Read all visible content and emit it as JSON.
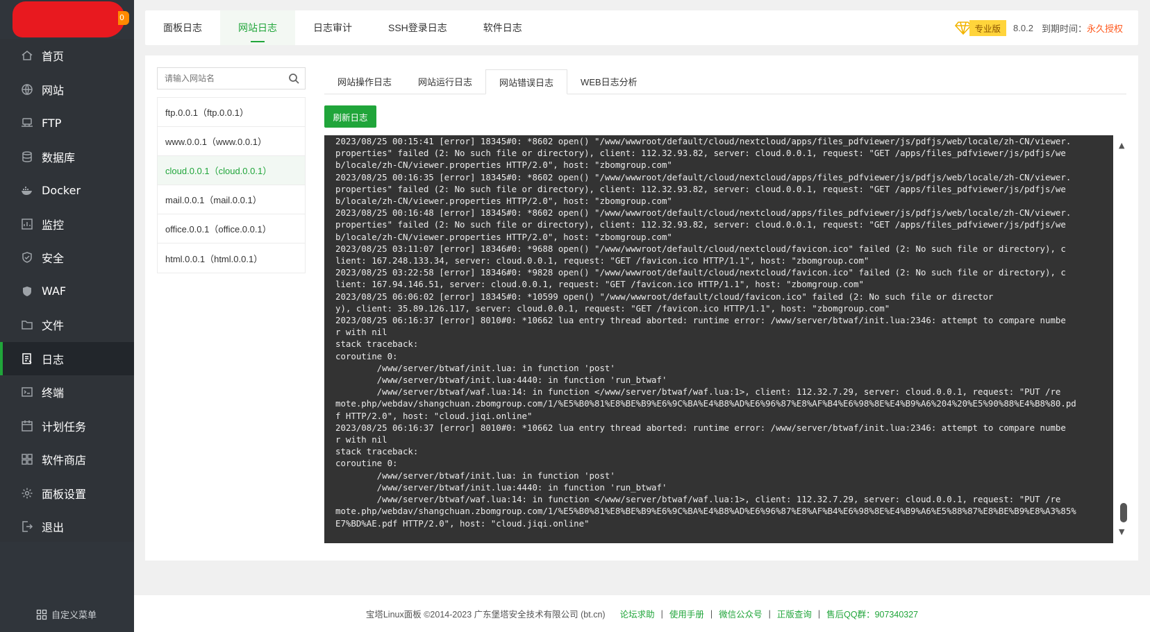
{
  "sidebar": {
    "brand_badge": "0",
    "items": [
      {
        "label": "首页",
        "icon": "home-icon"
      },
      {
        "label": "网站",
        "icon": "globe-icon"
      },
      {
        "label": "FTP",
        "icon": "ftp-icon"
      },
      {
        "label": "数据库",
        "icon": "database-icon"
      },
      {
        "label": "Docker",
        "icon": "docker-icon"
      },
      {
        "label": "监控",
        "icon": "monitor-icon"
      },
      {
        "label": "安全",
        "icon": "shield-icon"
      },
      {
        "label": "WAF",
        "icon": "waf-shield-icon"
      },
      {
        "label": "文件",
        "icon": "folder-icon"
      },
      {
        "label": "日志",
        "icon": "log-icon"
      },
      {
        "label": "终端",
        "icon": "terminal-icon"
      },
      {
        "label": "计划任务",
        "icon": "calendar-icon"
      },
      {
        "label": "软件商店",
        "icon": "grid-icon"
      },
      {
        "label": "面板设置",
        "icon": "gear-icon"
      },
      {
        "label": "退出",
        "icon": "logout-icon"
      }
    ],
    "custom_menu": "自定义菜单"
  },
  "topnav": {
    "tabs": [
      "面板日志",
      "网站日志",
      "日志审计",
      "SSH登录日志",
      "软件日志"
    ],
    "pro_label": "专业版",
    "version": "8.0.2",
    "expire_label": "到期时间：",
    "expire_value": "永久授权"
  },
  "search": {
    "placeholder": "请输入网站名"
  },
  "sites": [
    "ftp.0.0.1（ftp.0.0.1）",
    "www.0.0.1（www.0.0.1）",
    "cloud.0.0.1（cloud.0.0.1）",
    "mail.0.0.1（mail.0.0.1）",
    "office.0.0.1（office.0.0.1）",
    "html.0.0.1（html.0.0.1）"
  ],
  "subtabs": [
    "网站操作日志",
    "网站运行日志",
    "网站错误日志",
    "WEB日志分析"
  ],
  "refresh_label": "刷新日志",
  "log": {
    "text": "2023/08/25 00:15:41 [error] 18345#0: *8602 open() \"/www/wwwroot/default/cloud/nextcloud/apps/files_pdfviewer/js/pdfjs/web/locale/zh-CN/viewer.\nproperties\" failed (2: No such file or directory), client: 112.32.93.82, server: cloud.0.0.1, request: \"GET /apps/files_pdfviewer/js/pdfjs/we\nb/locale/zh-CN/viewer.properties HTTP/2.0\", host: \"zbomgroup.com\"\n2023/08/25 00:16:35 [error] 18345#0: *8602 open() \"/www/wwwroot/default/cloud/nextcloud/apps/files_pdfviewer/js/pdfjs/web/locale/zh-CN/viewer.\nproperties\" failed (2: No such file or directory), client: 112.32.93.82, server: cloud.0.0.1, request: \"GET /apps/files_pdfviewer/js/pdfjs/we\nb/locale/zh-CN/viewer.properties HTTP/2.0\", host: \"zbomgroup.com\"\n2023/08/25 00:16:48 [error] 18345#0: *8602 open() \"/www/wwwroot/default/cloud/nextcloud/apps/files_pdfviewer/js/pdfjs/web/locale/zh-CN/viewer.\nproperties\" failed (2: No such file or directory), client: 112.32.93.82, server: cloud.0.0.1, request: \"GET /apps/files_pdfviewer/js/pdfjs/we\nb/locale/zh-CN/viewer.properties HTTP/2.0\", host: \"zbomgroup.com\"\n2023/08/25 03:11:07 [error] 18346#0: *9688 open() \"/www/wwwroot/default/cloud/nextcloud/favicon.ico\" failed (2: No such file or directory), c\nlient: 167.248.133.34, server: cloud.0.0.1, request: \"GET /favicon.ico HTTP/1.1\", host: \"zbomgroup.com\"\n2023/08/25 03:22:58 [error] 18346#0: *9828 open() \"/www/wwwroot/default/cloud/nextcloud/favicon.ico\" failed (2: No such file or directory), c\nlient: 167.94.146.51, server: cloud.0.0.1, request: \"GET /favicon.ico HTTP/1.1\", host: \"zbomgroup.com\"\n2023/08/25 06:06:02 [error] 18345#0: *10599 open() \"/www/wwwroot/default/cloud/favicon.ico\" failed (2: No such file or director\ny), client: 35.89.126.117, server: cloud.0.0.1, request: \"GET /favicon.ico HTTP/1.1\", host: \"zbomgroup.com\"\n2023/08/25 06:16:37 [error] 8010#0: *10662 lua entry thread aborted: runtime error: /www/server/btwaf/init.lua:2346: attempt to compare numbe\nr with nil\nstack traceback:\ncoroutine 0:\n        /www/server/btwaf/init.lua: in function 'post'\n        /www/server/btwaf/init.lua:4440: in function 'run_btwaf'\n        /www/server/btwaf/waf.lua:14: in function </www/server/btwaf/waf.lua:1>, client: 112.32.7.29, server: cloud.0.0.1, request: \"PUT /re\nmote.php/webdav/shangchuan.zbomgroup.com/1/%E5%B0%81%E8%BE%B9%E6%9C%BA%E4%B8%AD%E6%96%87%E8%AF%B4%E6%98%8E%E4%B9%A6%204%20%E5%90%88%E4%B8%80.pd\nf HTTP/2.0\", host: \"cloud.jiqi.online\"\n2023/08/25 06:16:37 [error] 8010#0: *10662 lua entry thread aborted: runtime error: /www/server/btwaf/init.lua:2346: attempt to compare numbe\nr with nil\nstack traceback:\ncoroutine 0:\n        /www/server/btwaf/init.lua: in function 'post'\n        /www/server/btwaf/init.lua:4440: in function 'run_btwaf'\n        /www/server/btwaf/waf.lua:14: in function </www/server/btwaf/waf.lua:1>, client: 112.32.7.29, server: cloud.0.0.1, request: \"PUT /re\nmote.php/webdav/shangchuan.zbomgroup.com/1/%E5%B0%81%E8%BE%B9%E6%9C%BA%E4%B8%AD%E6%96%87%E8%AF%B4%E6%98%8E%E4%B9%A6%E5%88%87%E8%BE%B9%E8%A3%85%\nE7%BD%AE.pdf HTTP/2.0\", host: \"cloud.jiqi.online\""
  },
  "footer": {
    "copyright": "宝塔Linux面板 ©2014-2023 广东堡塔安全技术有限公司 (bt.cn)",
    "links": [
      "论坛求助",
      "使用手册",
      "微信公众号",
      "正版查询",
      "售后QQ群：907340327"
    ]
  },
  "colors": {
    "accent": "#20a53a",
    "sidebar_bg": "#30353b",
    "log_bg": "#333333",
    "expire": "#ff5a1f"
  }
}
